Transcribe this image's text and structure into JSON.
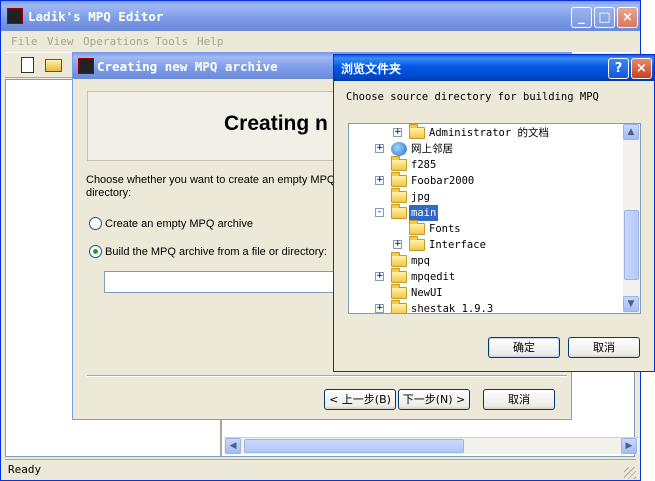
{
  "main_window": {
    "title": "Ladik's MPQ Editor",
    "menu": [
      "File",
      "View",
      "Operations",
      "Tools",
      "Help"
    ],
    "status": "Ready",
    "title_buttons": {
      "minimize": "_",
      "maximize": "□",
      "close": "×"
    }
  },
  "wizard": {
    "title": "Creating new MPQ archive",
    "heading": "Creating n",
    "prompt": "Choose whether you want to create an empty MPQ directory:",
    "options": [
      {
        "label": "Create an empty MPQ archive",
        "checked": false
      },
      {
        "label": "Build the MPQ archive from a file or directory:",
        "checked": true
      }
    ],
    "path_value": "",
    "buttons": {
      "back": "< 上一步(B)",
      "next": "下一步(N) >",
      "cancel": "取消"
    }
  },
  "browse_dialog": {
    "title": "浏览文件夹",
    "help_button": "?",
    "close_button": "×",
    "instruction": "Choose source directory for building MPQ",
    "tree": [
      {
        "label": "Administrator 的文档",
        "expander": "+",
        "icon": "folder-icon",
        "selected": false
      },
      {
        "label": "网上邻居",
        "expander": "+",
        "icon": "network-icon",
        "selected": false
      },
      {
        "label": "f285",
        "expander": "",
        "icon": "folder-icon",
        "selected": false
      },
      {
        "label": "Foobar2000",
        "expander": "+",
        "icon": "folder-icon",
        "selected": false
      },
      {
        "label": "jpg",
        "expander": "",
        "icon": "folder-icon",
        "selected": false
      },
      {
        "label": "main",
        "expander": "-",
        "icon": "folder-open-icon",
        "selected": true
      },
      {
        "label": "Fonts",
        "expander": "",
        "icon": "folder-icon",
        "selected": false
      },
      {
        "label": "Interface",
        "expander": "+",
        "icon": "folder-icon",
        "selected": false
      },
      {
        "label": "mpq",
        "expander": "",
        "icon": "folder-icon",
        "selected": false
      },
      {
        "label": "mpqedit",
        "expander": "+",
        "icon": "folder-icon",
        "selected": false
      },
      {
        "label": "NewUI",
        "expander": "",
        "icon": "folder-icon",
        "selected": false
      },
      {
        "label": "shestak 1.9.3",
        "expander": "+",
        "icon": "folder-icon",
        "selected": false
      }
    ],
    "buttons": {
      "ok": "确定",
      "cancel": "取消"
    }
  },
  "colors": {
    "titlebar_active": "#0058e6",
    "selection": "#316ac5",
    "window_bg": "#ece9d8"
  }
}
